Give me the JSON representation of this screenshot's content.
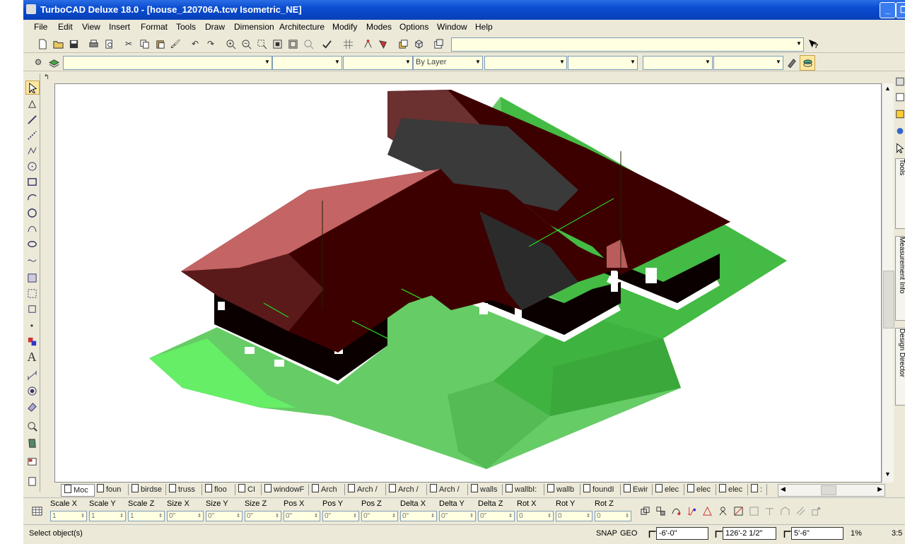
{
  "window": {
    "title": "TurboCAD Deluxe 18.0 - [house_120706A.tcw Isometric_NE]",
    "minimize_glyph": "_",
    "restore_glyph": "❐"
  },
  "menu": [
    "File",
    "Edit",
    "View",
    "Insert",
    "Format",
    "Tools",
    "Draw",
    "Dimension",
    "Architecture",
    "Modify",
    "Modes",
    "Options",
    "Window",
    "Help"
  ],
  "toolbar2": {
    "layer_combo_value": "By Layer"
  },
  "right_panel_tabs": [
    "Tools",
    "Measurement Info",
    "Design Director"
  ],
  "sheet_tabs": [
    "Moc",
    "foun",
    "birdse",
    "truss",
    "floo",
    "CI",
    "windowF",
    "Arch",
    "Arch /",
    "Arch /",
    "Arch /",
    "walls",
    "wallbI:",
    "wallb",
    "foundI",
    "Ewir",
    "elec",
    "elec",
    "elec",
    ":"
  ],
  "inspector": {
    "fields": [
      {
        "label": "Scale X",
        "value": "1"
      },
      {
        "label": "Scale Y",
        "value": "1"
      },
      {
        "label": "Scale Z",
        "value": "1"
      },
      {
        "label": "Size X",
        "value": "0\""
      },
      {
        "label": "Size Y",
        "value": "0\""
      },
      {
        "label": "Size Z",
        "value": "0\""
      },
      {
        "label": "Pos X",
        "value": "0\""
      },
      {
        "label": "Pos Y",
        "value": "0\""
      },
      {
        "label": "Pos Z",
        "value": "0\""
      },
      {
        "label": "Delta X",
        "value": "0\""
      },
      {
        "label": "Delta Y",
        "value": "0\""
      },
      {
        "label": "Delta Z",
        "value": "0\""
      },
      {
        "label": "Rot X",
        "value": "0"
      },
      {
        "label": "Rot Y",
        "value": "0"
      },
      {
        "label": "Rot Z",
        "value": "0"
      }
    ]
  },
  "status": {
    "message": "Select object(s)",
    "snap": "SNAP",
    "geo": "GEO",
    "coord_x": "-6'-0\"",
    "coord_y": "126'-2 1/2\"",
    "coord_z": "5'-6\"",
    "zoom": "1%",
    "time": "3:5"
  },
  "colors": {
    "roof_dark": "#3d0000",
    "roof_light": "#c46464",
    "roof_gray": "#3a3a3a",
    "wall": "#0a0000",
    "grass_light": "#66cc66",
    "grass_mid": "#44bb44",
    "grass_bright": "#66ee66",
    "titlebar": "#0a4cd0"
  }
}
